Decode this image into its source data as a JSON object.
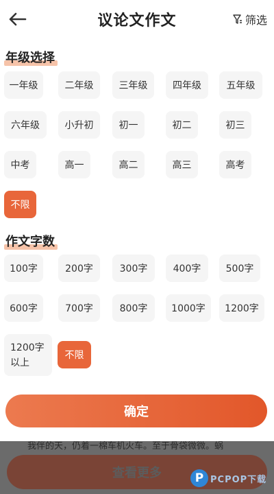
{
  "header": {
    "title": "议论文作文",
    "filter_label": "筛选"
  },
  "grade": {
    "title": "年级选择",
    "options": [
      "一年级",
      "二年级",
      "三年级",
      "四年级",
      "五年级",
      "六年级",
      "小升初",
      "初一",
      "初二",
      "初三",
      "中考",
      "高一",
      "高二",
      "高三",
      "高考",
      "不限"
    ],
    "selected": "不限"
  },
  "words": {
    "title": "作文字数",
    "options": [
      "100字",
      "200字",
      "300字",
      "400字",
      "500字",
      "600字",
      "700字",
      "800字",
      "1000字",
      "1200字",
      "1200字以上",
      "不限"
    ],
    "selected": "不限"
  },
  "confirm_label": "确定",
  "background": {
    "peek_text": "我伴的天，仍着一棉车机火车。至于骨袋微微。蜗",
    "more_label": "查看更多"
  },
  "watermark": {
    "text": "PCPOP下载"
  },
  "colors": {
    "accent": "#e8663a",
    "highlight": "#f6c3a9",
    "chip_bg": "#f5f5f5"
  }
}
